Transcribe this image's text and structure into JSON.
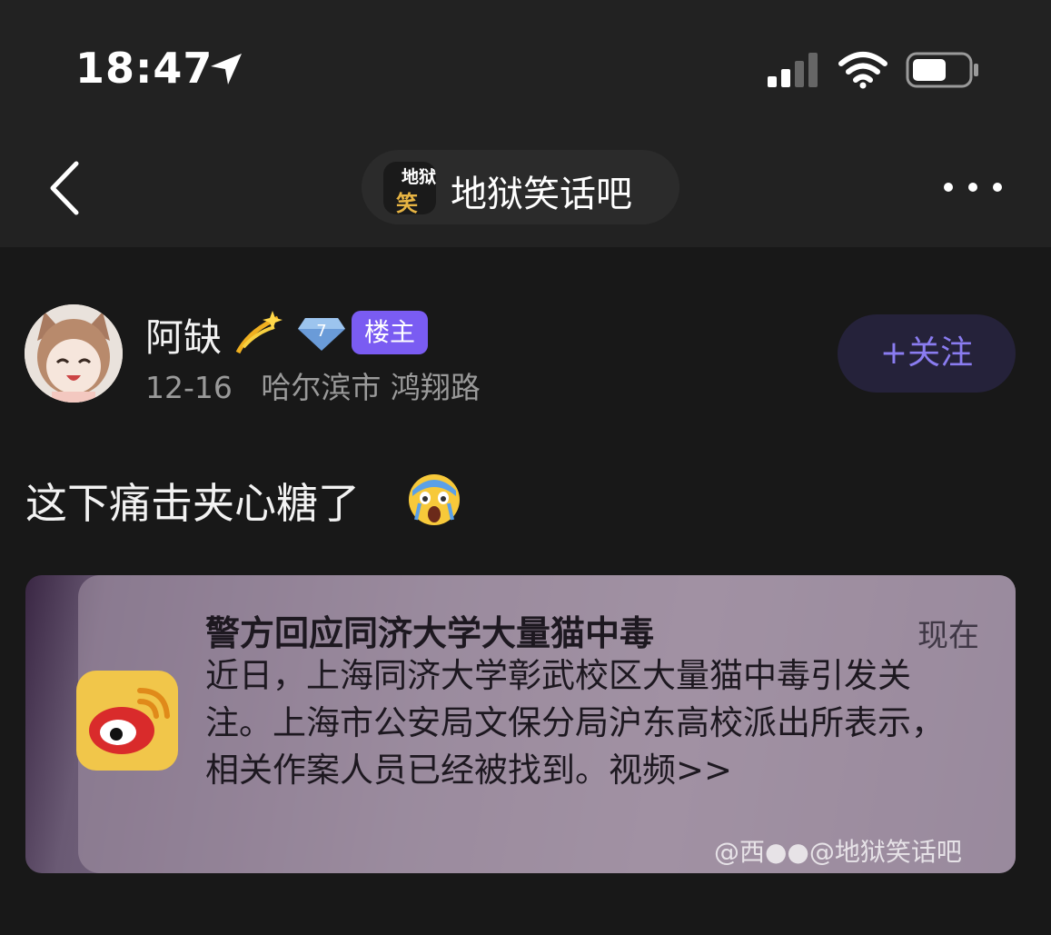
{
  "status_bar": {
    "time": "18:47"
  },
  "nav": {
    "forum_name": "地狱笑话吧",
    "forum_avatar_text_top": "地狱",
    "forum_avatar_text_bottom": "笑话"
  },
  "post": {
    "author": "阿缺",
    "level": "7",
    "owner_badge": "楼主",
    "date": "12-16",
    "location": "哈尔滨市 鸿翔路",
    "follow_label": "+关注",
    "text": "这下痛击夹心糖了"
  },
  "image": {
    "notif_title": "警方回应同济大学大量猫中毒",
    "notif_time": "现在",
    "notif_body": "近日，上海同济大学彰武校区大量猫中毒引发关注。上海市公安局文保分局沪东高校派出所表示，相关作案人员已经被找到。视频>>",
    "watermark": "@西●●@地狱笑话吧"
  },
  "colors": {
    "accent": "#7a5cf2",
    "follow_text": "#8a7cf0",
    "background": "#181818",
    "bar": "#222222"
  }
}
